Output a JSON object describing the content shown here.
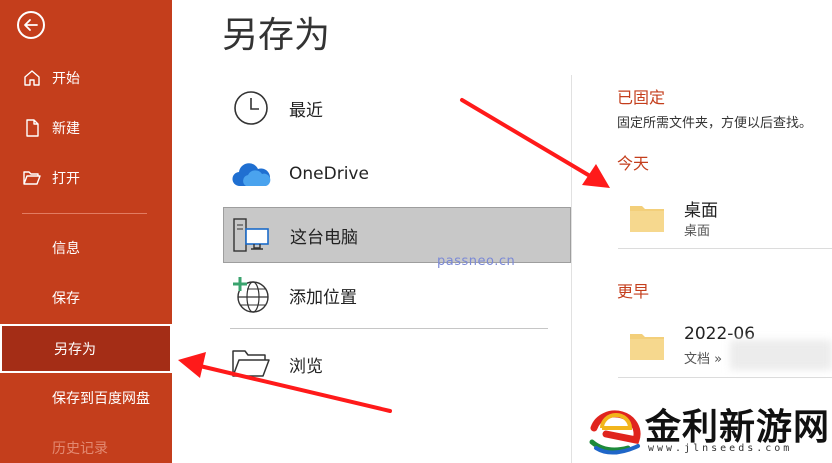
{
  "sidebar": {
    "items": [
      {
        "label": "开始",
        "icon": "home-icon"
      },
      {
        "label": "新建",
        "icon": "new-file-icon"
      },
      {
        "label": "打开",
        "icon": "folder-open-icon"
      },
      {
        "label": "信息"
      },
      {
        "label": "保存"
      },
      {
        "label": "另存为",
        "active": true
      },
      {
        "label": "保存到百度网盘"
      },
      {
        "label": "历史记录"
      }
    ]
  },
  "page": {
    "title": "另存为"
  },
  "locations": [
    {
      "label": "最近",
      "icon": "clock-icon"
    },
    {
      "label": "OneDrive",
      "icon": "cloud-icon"
    },
    {
      "label": "这台电脑",
      "icon": "pc-icon",
      "selected": true
    },
    {
      "label": "添加位置",
      "icon": "globe-add-icon"
    },
    {
      "label": "浏览",
      "icon": "folder-browse-icon"
    }
  ],
  "watermark": {
    "text": "passneo.cn"
  },
  "right_panel": {
    "pinned": {
      "heading": "已固定",
      "description": "固定所需文件夹，方便以后查找。"
    },
    "today": {
      "heading": "今天",
      "folders": [
        {
          "name": "桌面",
          "path": "桌面"
        }
      ]
    },
    "earlier": {
      "heading": "更早",
      "folders": [
        {
          "name": "2022-06",
          "path": "文档 »"
        }
      ]
    }
  },
  "logo": {
    "text": "金利新游网",
    "url": "www.jlnseeds.com"
  },
  "colors": {
    "accent": "#c43e1c",
    "active": "#a42d16",
    "arrow": "#ff1a1a"
  }
}
